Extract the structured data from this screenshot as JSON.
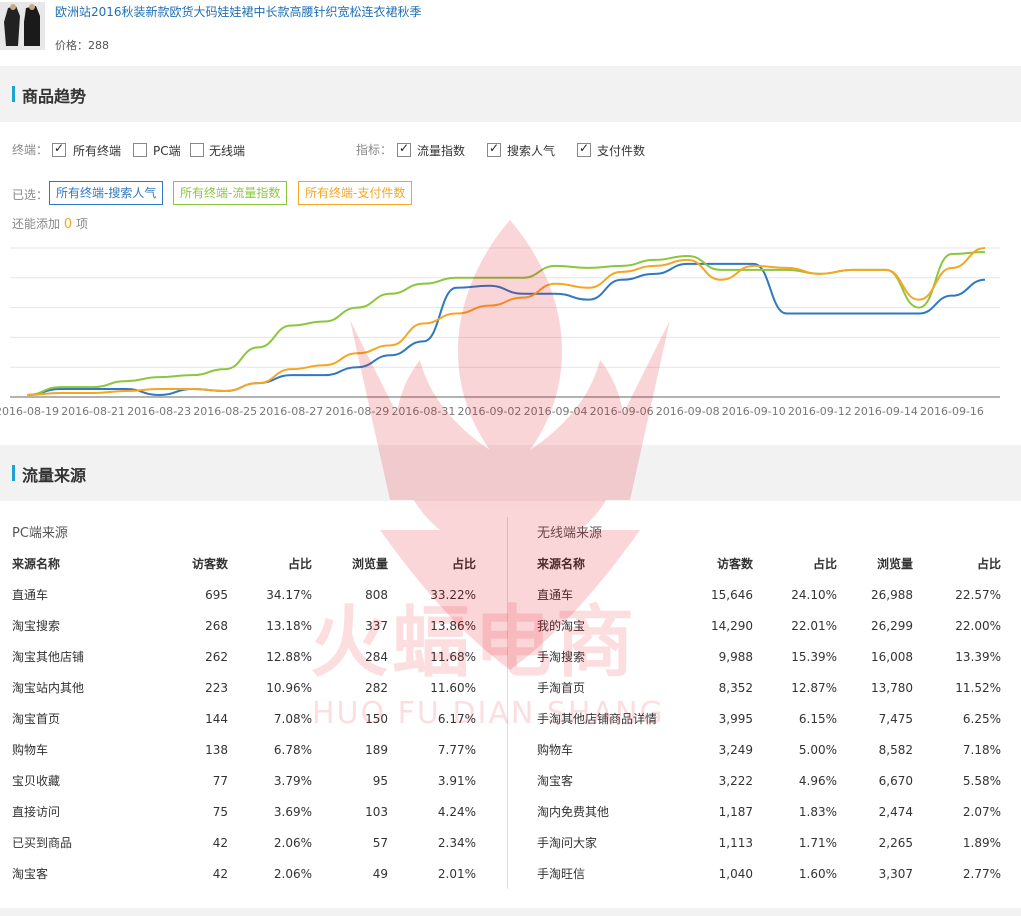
{
  "product": {
    "title": "欧洲站2016秋装新款欧货大码娃娃裙中长款高腰针织宽松连衣裙秋季",
    "price_label": "价格：288"
  },
  "trend": {
    "section_title": "商品趋势",
    "terminal_label": "终端：",
    "terminals": [
      {
        "label": "所有终端",
        "checked": true
      },
      {
        "label": "PC端",
        "checked": false
      },
      {
        "label": "无线端",
        "checked": false
      }
    ],
    "metric_label": "指标：",
    "metrics": [
      {
        "label": "流量指数",
        "checked": true
      },
      {
        "label": "搜索人气",
        "checked": true
      },
      {
        "label": "支付件数",
        "checked": true
      }
    ],
    "selected_label": "已选：",
    "selected_tags": [
      {
        "label": "所有终端-搜索人气",
        "color": "#2f78c4"
      },
      {
        "label": "所有终端-流量指数",
        "color": "#8cc63f"
      },
      {
        "label": "所有终端-支付件数",
        "color": "#f5a623"
      }
    ],
    "can_add_prefix": "还能添加",
    "can_add_count": "0",
    "can_add_suffix": "项"
  },
  "chart_data": {
    "type": "line",
    "x": [
      "2016-08-19",
      "2016-08-20",
      "2016-08-21",
      "2016-08-22",
      "2016-08-23",
      "2016-08-24",
      "2016-08-25",
      "2016-08-26",
      "2016-08-27",
      "2016-08-28",
      "2016-08-29",
      "2016-08-30",
      "2016-08-31",
      "2016-09-01",
      "2016-09-02",
      "2016-09-03",
      "2016-09-04",
      "2016-09-05",
      "2016-09-06",
      "2016-09-07",
      "2016-09-08",
      "2016-09-09",
      "2016-09-10",
      "2016-09-11",
      "2016-09-12",
      "2016-09-13",
      "2016-09-14",
      "2016-09-15",
      "2016-09-16",
      "2016-09-17"
    ],
    "tick_labels": [
      "2016-08-19",
      "2016-08-21",
      "2016-08-23",
      "2016-08-25",
      "2016-08-27",
      "2016-08-29",
      "2016-08-31",
      "2016-09-02",
      "2016-09-04",
      "2016-09-06",
      "2016-09-08",
      "2016-09-10",
      "2016-09-12",
      "2016-09-14",
      "2016-09-16"
    ],
    "ylim": [
      0,
      150
    ],
    "grid": true,
    "series": [
      {
        "name": "所有终端-搜索人气",
        "color": "#2f78c4",
        "values": [
          2,
          8,
          8,
          8,
          2,
          8,
          6,
          14,
          22,
          22,
          30,
          42,
          56,
          110,
          112,
          104,
          104,
          98,
          118,
          124,
          134,
          134,
          134,
          84,
          84,
          84,
          84,
          84,
          102,
          118
        ]
      },
      {
        "name": "所有终端-流量指数",
        "color": "#8cc63f",
        "values": [
          2,
          10,
          10,
          16,
          20,
          22,
          28,
          50,
          72,
          76,
          90,
          104,
          114,
          120,
          120,
          120,
          132,
          130,
          132,
          138,
          142,
          128,
          128,
          128,
          124,
          128,
          128,
          90,
          144,
          146
        ]
      },
      {
        "name": "所有终端-支付件数",
        "color": "#f5a623",
        "values": [
          2,
          4,
          4,
          6,
          8,
          8,
          6,
          14,
          28,
          32,
          44,
          52,
          74,
          84,
          92,
          100,
          114,
          110,
          126,
          132,
          138,
          118,
          132,
          130,
          124,
          128,
          128,
          98,
          130,
          150
        ]
      }
    ]
  },
  "traffic": {
    "section_title": "流量来源",
    "pc": {
      "title": "PC端来源",
      "headers": [
        "来源名称",
        "访客数",
        "占比",
        "浏览量",
        "占比"
      ],
      "rows": [
        [
          "直通车",
          "695",
          "34.17%",
          "808",
          "33.22%"
        ],
        [
          "淘宝搜索",
          "268",
          "13.18%",
          "337",
          "13.86%"
        ],
        [
          "淘宝其他店铺",
          "262",
          "12.88%",
          "284",
          "11.68%"
        ],
        [
          "淘宝站内其他",
          "223",
          "10.96%",
          "282",
          "11.60%"
        ],
        [
          "淘宝首页",
          "144",
          "7.08%",
          "150",
          "6.17%"
        ],
        [
          "购物车",
          "138",
          "6.78%",
          "189",
          "7.77%"
        ],
        [
          "宝贝收藏",
          "77",
          "3.79%",
          "95",
          "3.91%"
        ],
        [
          "直接访问",
          "75",
          "3.69%",
          "103",
          "4.24%"
        ],
        [
          "已买到商品",
          "42",
          "2.06%",
          "57",
          "2.34%"
        ],
        [
          "淘宝客",
          "42",
          "2.06%",
          "49",
          "2.01%"
        ]
      ]
    },
    "mobile": {
      "title": "无线端来源",
      "headers": [
        "来源名称",
        "访客数",
        "占比",
        "浏览量",
        "占比"
      ],
      "rows": [
        [
          "直通车",
          "15,646",
          "24.10%",
          "26,988",
          "22.57%"
        ],
        [
          "我的淘宝",
          "14,290",
          "22.01%",
          "26,299",
          "22.00%"
        ],
        [
          "手淘搜索",
          "9,988",
          "15.39%",
          "16,008",
          "13.39%"
        ],
        [
          "手淘首页",
          "8,352",
          "12.87%",
          "13,780",
          "11.52%"
        ],
        [
          "手淘其他店铺商品详情",
          "3,995",
          "6.15%",
          "7,475",
          "6.25%"
        ],
        [
          "购物车",
          "3,249",
          "5.00%",
          "8,582",
          "7.18%"
        ],
        [
          "淘宝客",
          "3,222",
          "4.96%",
          "6,670",
          "5.58%"
        ],
        [
          "淘内免费其他",
          "1,187",
          "1.83%",
          "2,474",
          "2.07%"
        ],
        [
          "手淘问大家",
          "1,113",
          "1.71%",
          "2,265",
          "1.89%"
        ],
        [
          "手淘旺信",
          "1,040",
          "1.60%",
          "3,307",
          "2.77%"
        ]
      ]
    }
  },
  "watermark": {
    "text": "火蝠电商",
    "pinyin": "HUO FU DIAN SHANG"
  }
}
